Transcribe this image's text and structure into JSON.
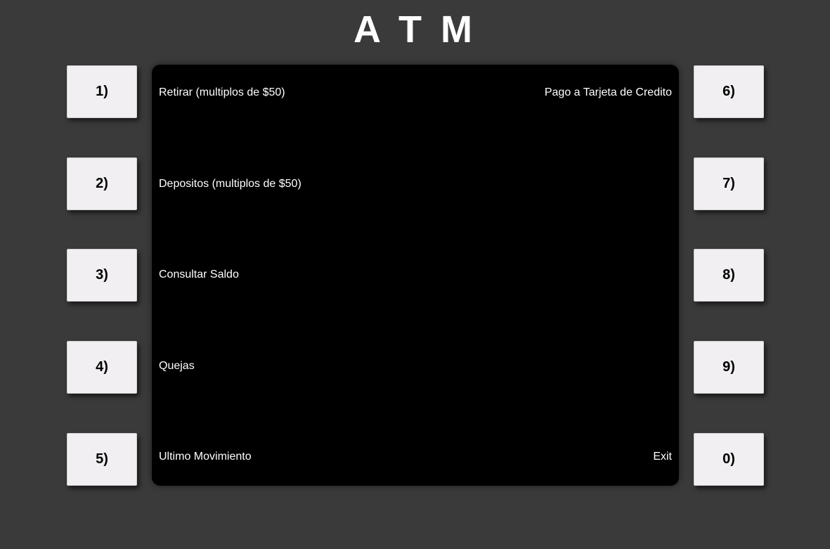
{
  "title": "A T M",
  "keys": {
    "left": [
      "1)",
      "2)",
      "3)",
      "4)",
      "5)"
    ],
    "right": [
      "6)",
      "7)",
      "8)",
      "9)",
      "0)"
    ]
  },
  "screen": {
    "left_options": [
      "Retirar (multiplos de $50)",
      "Depositos (multiplos de $50)",
      "Consultar Saldo",
      "Quejas",
      "Ultimo Movimiento"
    ],
    "right_options": {
      "option_6": "Pago a Tarjeta de Credito",
      "option_0": "Exit"
    }
  },
  "colors": {
    "background": "#3b3a3b",
    "screen": "#000000",
    "key": "#f1eff1",
    "text": "#ffffff"
  }
}
